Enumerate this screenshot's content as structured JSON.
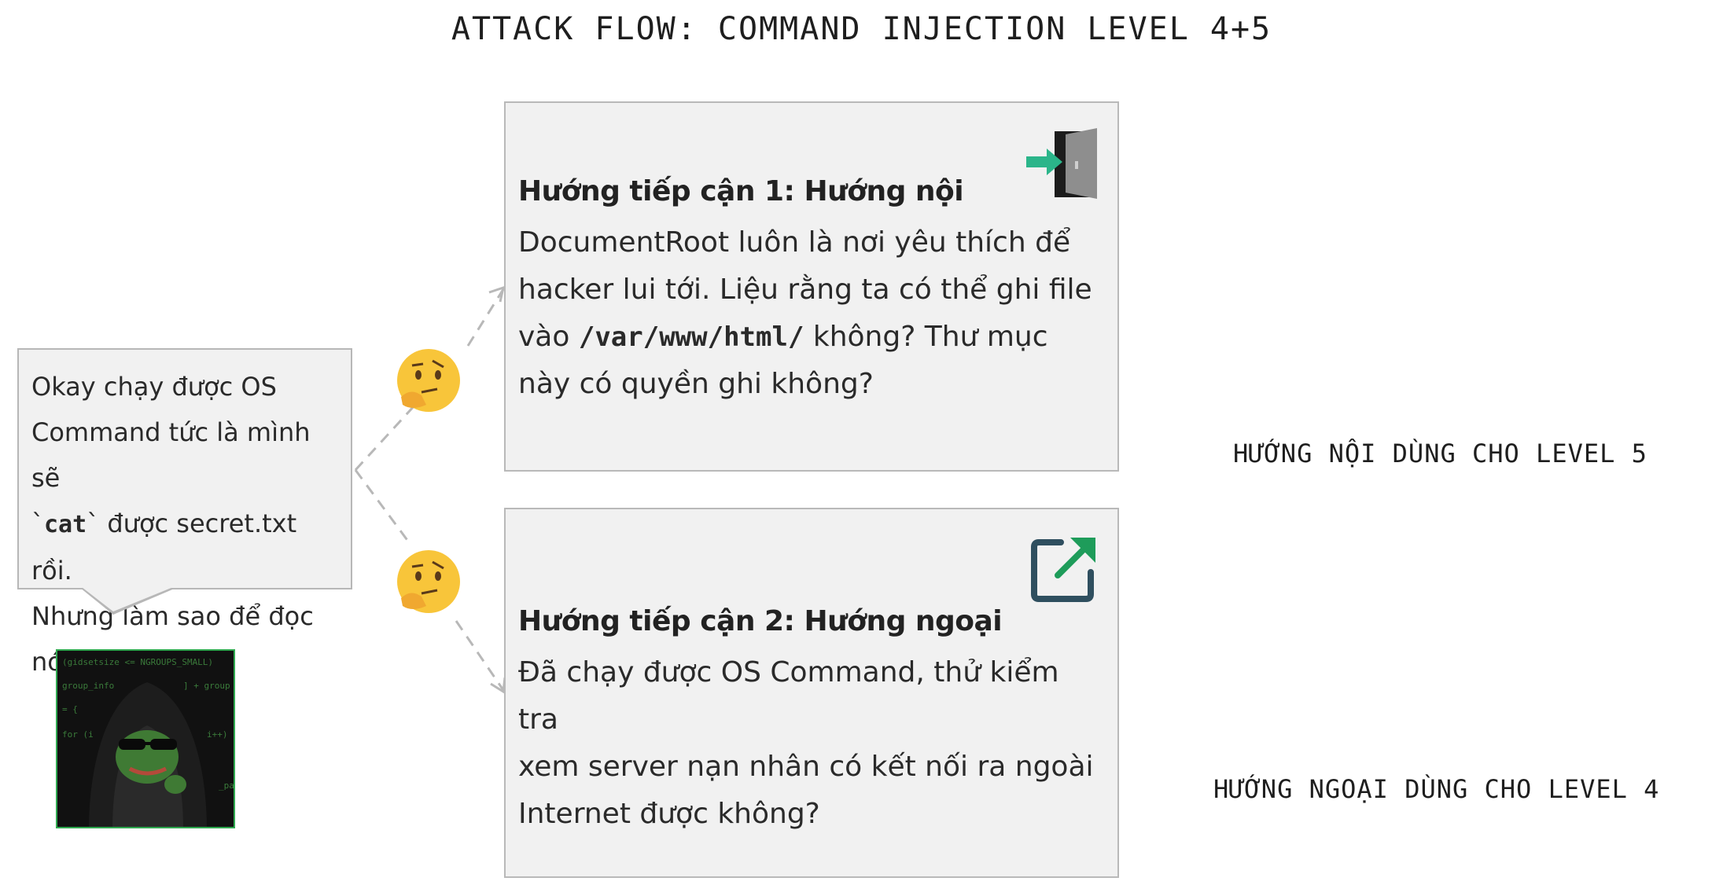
{
  "title": "ATTACK FLOW: COMMAND INJECTION LEVEL 4+5",
  "bubble": {
    "line1": "Okay chạy được OS",
    "line2": "Command tức là mình sẽ",
    "line3_pre": "`",
    "line3_code": "cat",
    "line3_post": "` được secret.txt rồi.",
    "line4": "Nhưng làm sao để đọc",
    "line5": "nó ra đây?"
  },
  "avatar": {
    "code_lines": [
      "(gidsetsize <= NGROUPS_SMALL)",
      "group_info",
      "] + group",
      "= {",
      "for (i",
      "i++)",
      "_pa"
    ]
  },
  "card1": {
    "heading": "Hướng tiếp cận 1: Hướng nội",
    "line1": "DocumentRoot luôn là nơi yêu thích để",
    "line2": "hacker lui tới. Liệu rằng ta có thể ghi file",
    "line3_pre": "vào ",
    "line3_code": "/var/www/html/",
    "line3_post": " không? Thư mục",
    "line4": "này có quyền ghi không?",
    "icon": "door-enter-icon"
  },
  "card2": {
    "heading": "Hướng tiếp cận 2: Hướng ngoại",
    "line1": "Đã chạy được OS Command, thử kiểm tra",
    "line2": "xem server nạn nhân có kết nối ra ngoài",
    "line3": "Internet được không?",
    "icon": "external-link-icon"
  },
  "notes": {
    "level5": "HƯỚNG NỘI DÙNG CHO LEVEL 5",
    "level4": "HƯỚNG NGOẠI DÙNG CHO LEVEL 4"
  },
  "emojis": [
    "thinking-face-icon",
    "thinking-face-icon"
  ],
  "colors": {
    "card_bg": "#f1f1f1",
    "border": "#b9b9b9",
    "enter_arrow": "#2bb58a",
    "link_icon": "#2f4f5f",
    "link_arrow": "#1e9c5a"
  }
}
